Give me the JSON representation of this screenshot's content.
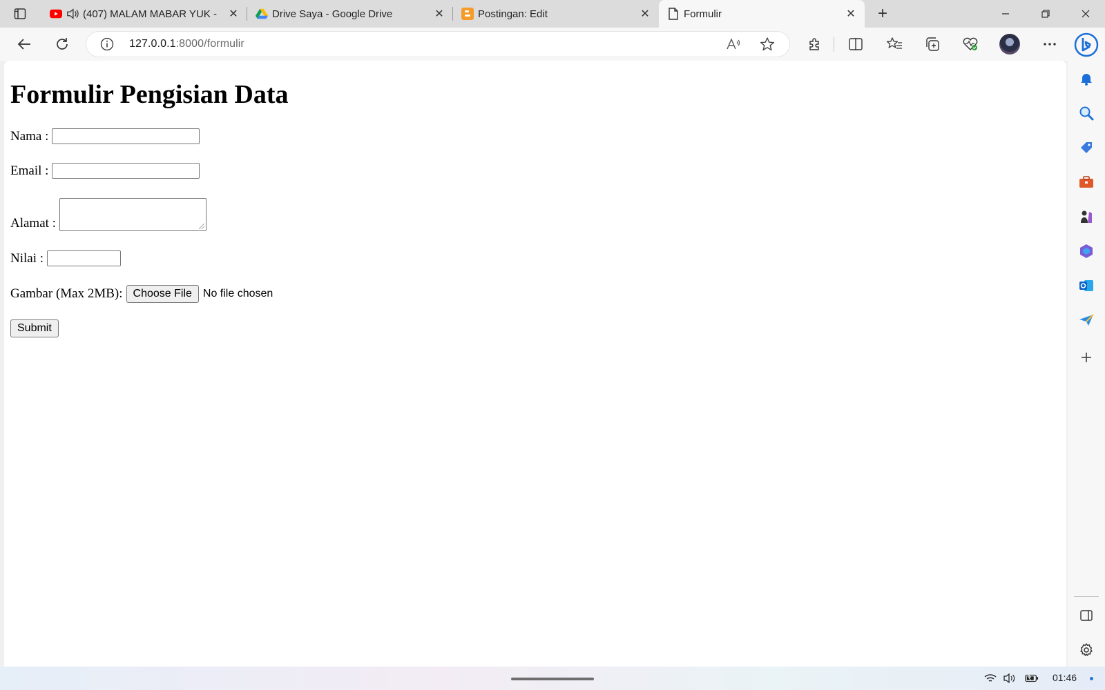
{
  "browser": {
    "tabs": [
      {
        "title": "(407) MALAM MABAR YUK -",
        "favicon": "youtube-icon",
        "audio": true,
        "active": false
      },
      {
        "title": "Drive Saya - Google Drive",
        "favicon": "google-drive-icon",
        "active": false
      },
      {
        "title": "Postingan: Edit",
        "favicon": "blogger-icon",
        "active": false
      },
      {
        "title": "Formulir",
        "favicon": "page-icon",
        "active": true
      }
    ],
    "address": {
      "host": "127.0.0.1",
      "path": ":8000/formulir"
    }
  },
  "form": {
    "title": "Formulir Pengisian Data",
    "nama_label": "Nama :",
    "email_label": "Email :",
    "alamat_label": "Alamat :",
    "nilai_label": "Nilai :",
    "gambar_label": "Gambar (Max 2MB):",
    "choose_file_label": "Choose File",
    "no_file_text": "No file chosen",
    "submit_label": "Submit"
  },
  "taskbar": {
    "clock": "01:46"
  },
  "colors": {
    "accent": "#2a74d6",
    "youtube": "#ff0000",
    "blogger": "#f59b2a"
  }
}
